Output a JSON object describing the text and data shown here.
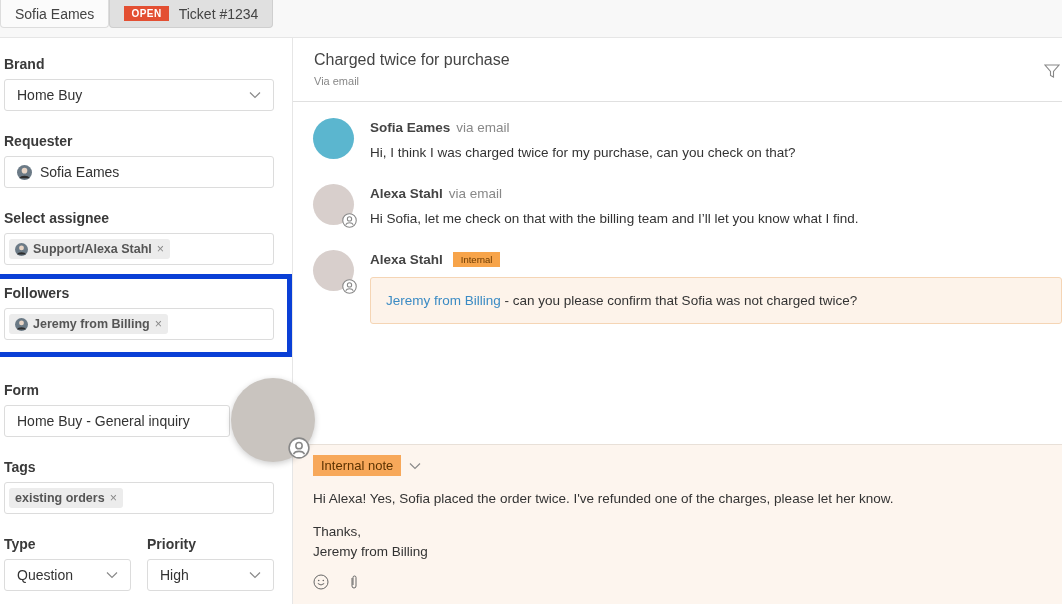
{
  "tabs": [
    {
      "label": "Sofia Eames",
      "selected": false
    },
    {
      "label": "Ticket #1234",
      "status": "OPEN",
      "selected": true
    }
  ],
  "sidebar": {
    "fields": [
      {
        "label": "Brand",
        "kind": "select",
        "value": "Home Buy",
        "highlighted": false
      },
      {
        "label": "Requester",
        "kind": "person",
        "value": "Sofia Eames",
        "highlighted": false
      },
      {
        "label": "Select assignee",
        "kind": "chip",
        "value": "Support/Alexa Stahl",
        "remove": "×",
        "avatar": true,
        "highlighted": false
      },
      {
        "label": "Followers",
        "kind": "chip",
        "value": "Jeremy from Billing",
        "remove": "×",
        "avatar": true,
        "highlighted": true
      },
      {
        "label": "Form",
        "kind": "text",
        "value": "Home Buy - General inquiry",
        "highlighted": false
      },
      {
        "label": "Tags",
        "kind": "chip",
        "value": "existing orders",
        "remove": "×",
        "avatar": false,
        "highlighted": false
      }
    ],
    "pair": [
      {
        "label": "Type",
        "kind": "select",
        "value": "Question"
      },
      {
        "label": "Priority",
        "kind": "select",
        "value": "High"
      }
    ]
  },
  "conversation": {
    "title": "Charged twice for purchase",
    "channel": "Via email",
    "messages": [
      {
        "author": "Sofia Eames",
        "via": "via email",
        "kind": "public",
        "agent": false,
        "text": "Hi, I think I was charged twice for my purchase, can you check on that?"
      },
      {
        "author": "Alexa Stahl",
        "via": "via email",
        "kind": "public",
        "agent": true,
        "text": "Hi Sofia, let me check on that with the billing team and I’ll let you know what I find."
      },
      {
        "author": "Alexa Stahl",
        "badge": "Internal",
        "kind": "internal",
        "agent": true,
        "mention": "Jeremy from Billing",
        "text": " - can you please confirm that Sofia was not charged twice?"
      }
    ]
  },
  "composer": {
    "mode": "Internal note",
    "paragraphs": [
      "Hi Alexa! Yes, Sofia placed the order twice. I've refunded one of the charges, please let her know.",
      "Thanks,\nJeremy from Billing"
    ]
  }
}
